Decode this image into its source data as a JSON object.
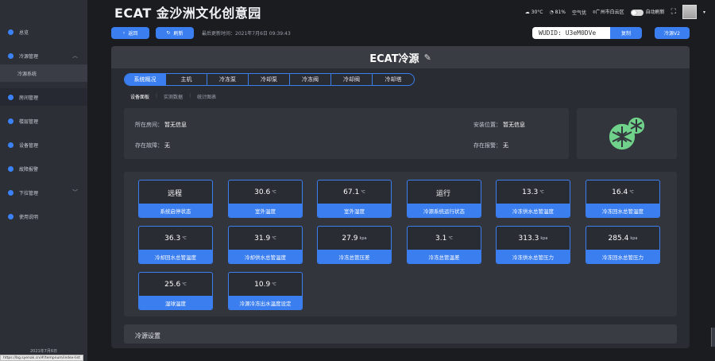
{
  "header": {
    "title": "ECAT 金沙洲文化创意园",
    "temperature": "30°C",
    "humidity": "81%",
    "air_quality": "空气优",
    "location": "广州市白云区",
    "auto_refresh_label": "自动刷新"
  },
  "sidebar": {
    "items": [
      {
        "label": "总览",
        "icon": "dashboard-icon"
      },
      {
        "label": "冷源管理",
        "icon": "snowflake-icon",
        "expanded": true
      },
      {
        "label": "冷源系统",
        "sub": true
      },
      {
        "label": "房间管理",
        "icon": "home-icon"
      },
      {
        "label": "楼层管理",
        "icon": "building-icon"
      },
      {
        "label": "设备管理",
        "icon": "device-icon"
      },
      {
        "label": "故障报警",
        "icon": "alarm-icon"
      },
      {
        "label": "下拉管理",
        "icon": "dropdown-icon",
        "expanded": false
      },
      {
        "label": "使用说明",
        "icon": "info-icon"
      }
    ],
    "footer_date": "2021年7月6日"
  },
  "url": "https://bg.syenak.cn/#/tempnum/index-list",
  "toolbar": {
    "back_label": "返回",
    "refresh_label": "刷新",
    "last_update": "最后更新时间：2021年7月6日 09:39:43",
    "wuid": "WUDID: U3eM0DVe",
    "copy_label": "复制",
    "version_label": "冷源V2"
  },
  "panel": {
    "title": "ECAT冷源",
    "tabs": [
      "系统概况",
      "主机",
      "冷冻泵",
      "冷却泵",
      "冷冻阀",
      "冷却阀",
      "冷却塔"
    ],
    "active_tab": 0,
    "subtabs": [
      "设备面板",
      "实测数据",
      "统计图表"
    ],
    "active_subtab": 0,
    "info": {
      "location_label": "所在房间：",
      "location_value": "暂无信息",
      "install_label": "安装位置：",
      "install_value": "暂无信息",
      "fault_label": "存在故障：",
      "fault_value": "无",
      "alarm_label": "存在报警：",
      "alarm_value": "无"
    },
    "metrics": [
      {
        "value": "远程",
        "unit": "",
        "label": "系统启停状态"
      },
      {
        "value": "30.6",
        "unit": "℃",
        "label": "室外温度"
      },
      {
        "value": "67.1",
        "unit": "℃",
        "label": "室外湿度"
      },
      {
        "value": "运行",
        "unit": "",
        "label": "冷源系统运行状态"
      },
      {
        "value": "13.3",
        "unit": "℃",
        "label": "冷冻供水总管温度"
      },
      {
        "value": "16.4",
        "unit": "℃",
        "label": "冷冻回水总管温度"
      },
      {
        "value": "36.3",
        "unit": "℃",
        "label": "冷却回水总管温度"
      },
      {
        "value": "31.9",
        "unit": "℃",
        "label": "冷却供水总管温度"
      },
      {
        "value": "27.9",
        "unit": "kpa",
        "label": "冷冻总管压差"
      },
      {
        "value": "3.1",
        "unit": "℃",
        "label": "冷冻总管温差"
      },
      {
        "value": "313.3",
        "unit": "kpa",
        "label": "冷冻供水总管压力"
      },
      {
        "value": "285.4",
        "unit": "kpa",
        "label": "冷冻回水总管压力"
      },
      {
        "value": "25.6",
        "unit": "℃",
        "label": "湿球温度"
      },
      {
        "value": "10.9",
        "unit": "℃",
        "label": "冷源冷冻出水温度设定"
      }
    ],
    "settings_title": "冷源设置"
  },
  "colors": {
    "accent": "#3a7ef0",
    "background": "#1b1c20",
    "panel": "#2a2c33",
    "logo_green": "#6fd18a"
  }
}
